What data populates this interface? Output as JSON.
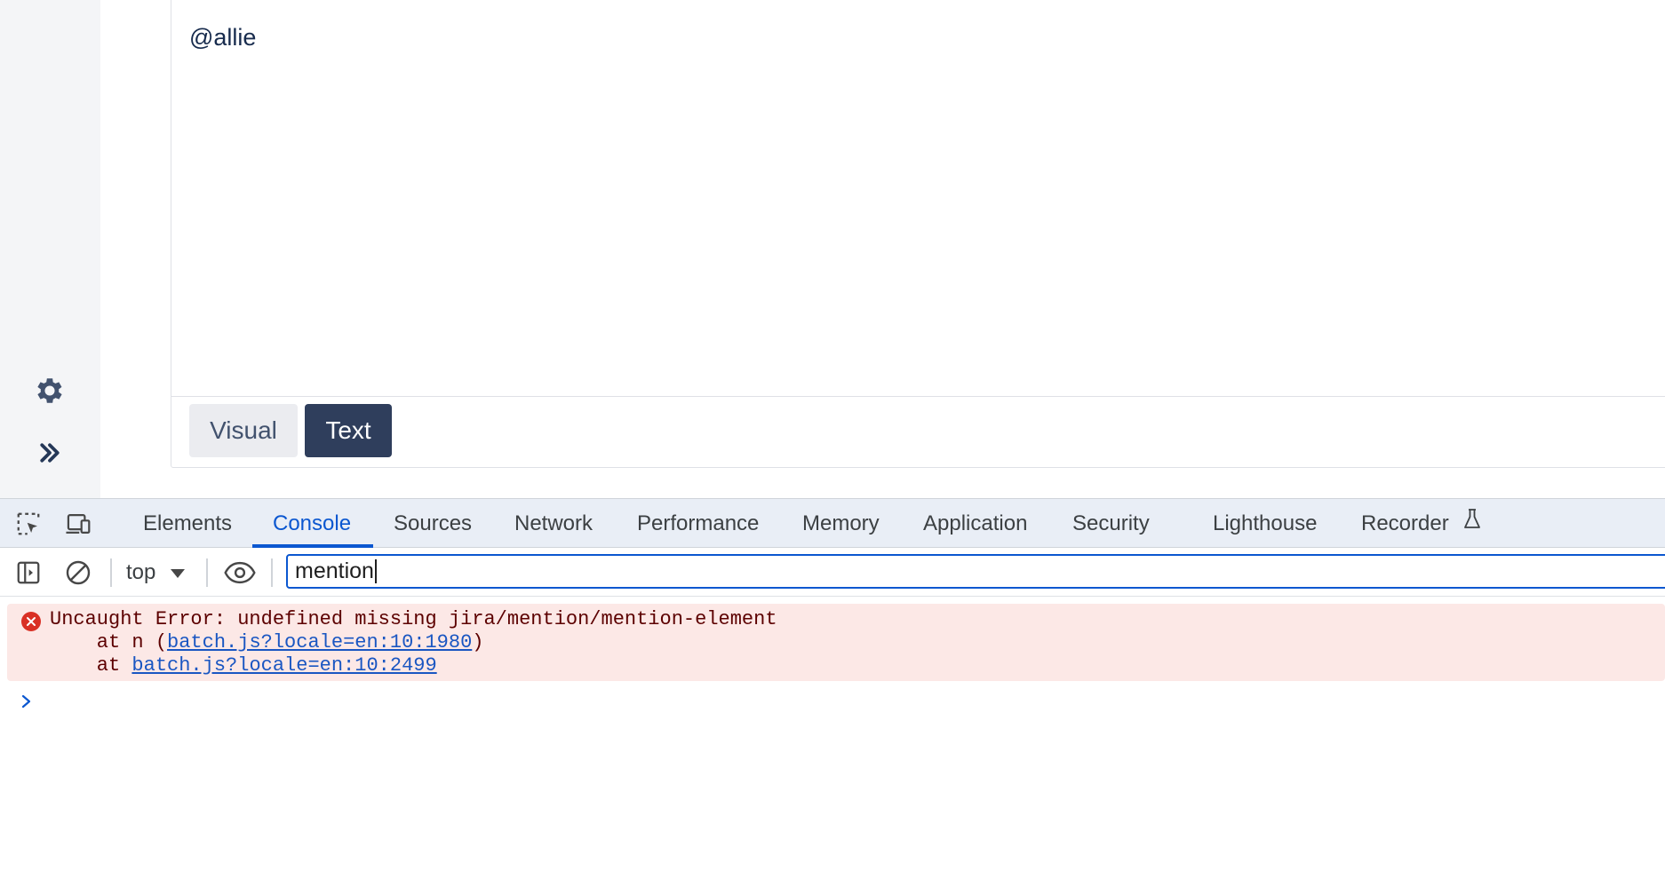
{
  "editor": {
    "content": "@allie",
    "mode_buttons": {
      "visual": "Visual",
      "text": "Text"
    }
  },
  "devtools": {
    "tabs": [
      "Elements",
      "Console",
      "Sources",
      "Network",
      "Performance",
      "Memory",
      "Application",
      "Security",
      "Lighthouse",
      "Recorder"
    ],
    "active_tab": "Console",
    "toolbar": {
      "context": "top",
      "filter_value": "mention"
    },
    "console": {
      "error": {
        "message": "Uncaught Error: undefined missing jira/mention/mention-element",
        "stack_1_prefix": "    at n (",
        "stack_1_link": "batch.js?locale=en:10:1980",
        "stack_1_suffix": ")",
        "stack_2_prefix": "    at ",
        "stack_2_link": "batch.js?locale=en:10:2499"
      }
    }
  },
  "colors": {
    "accent": "#0b57d0",
    "error_bg": "#fce8e6",
    "error_icon": "#d93025",
    "text_button_bg": "#2f3e5c"
  },
  "icons": {
    "rail": [
      "gear-icon",
      "double-chevron-right-icon"
    ],
    "devtools_tabbar": [
      "inspect-element-icon",
      "device-toolbar-icon",
      "flask-icon"
    ],
    "console_toolbar": [
      "sidebar-toggle-icon",
      "clear-console-icon",
      "dropdown-caret-icon",
      "eye-icon"
    ],
    "console": [
      "error-icon",
      "prompt-chevron-icon"
    ]
  }
}
